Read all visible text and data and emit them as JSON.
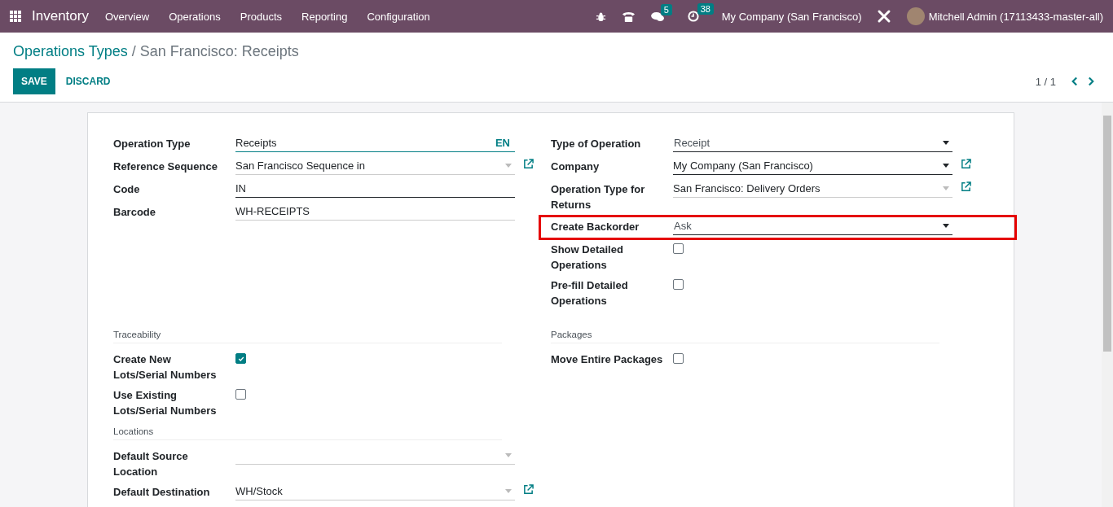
{
  "navbar": {
    "app_name": "Inventory",
    "menu": [
      "Overview",
      "Operations",
      "Products",
      "Reporting",
      "Configuration"
    ],
    "chat_badge": "5",
    "activity_badge": "38",
    "company": "My Company (San Francisco)",
    "user": "Mitchell Admin (17113433-master-all)"
  },
  "breadcrumb": {
    "parent": "Operations Types",
    "separator": "/",
    "current": "San Francisco: Receipts"
  },
  "buttons": {
    "save": "SAVE",
    "discard": "DISCARD"
  },
  "pager": "1 / 1",
  "left_fields": [
    {
      "kind": "translatable",
      "label": "Operation Type",
      "value": "Receipts",
      "lang": "EN",
      "required": false,
      "link": false
    },
    {
      "kind": "many2one",
      "label": "Reference Sequence",
      "value": "San Francisco Sequence in",
      "required": false,
      "link": true
    },
    {
      "kind": "text",
      "label": "Code",
      "value": "IN",
      "required": true,
      "link": false
    },
    {
      "kind": "text",
      "label": "Barcode",
      "value": "WH-RECEIPTS",
      "required": false,
      "link": false
    }
  ],
  "right_fields": [
    {
      "kind": "selection",
      "label": "Type of Operation",
      "value": "Receipt",
      "required": true,
      "link": false,
      "highlighted": false
    },
    {
      "kind": "many2one",
      "label": "Company",
      "value": "My Company (San Francisco)",
      "required": true,
      "link": true,
      "highlighted": false
    },
    {
      "kind": "many2one",
      "label": "Operation Type for Returns",
      "value": "San Francisco: Delivery Orders",
      "required": false,
      "link": true,
      "highlighted": false
    },
    {
      "kind": "selection",
      "label": "Create Backorder",
      "value": "Ask",
      "required": true,
      "link": false,
      "highlighted": true
    },
    {
      "kind": "checkbox",
      "label": "Show Detailed Operations",
      "checked": false,
      "highlighted": false
    },
    {
      "kind": "checkbox",
      "label": "Pre-fill Detailed Operations",
      "checked": false,
      "highlighted": false
    }
  ],
  "left_sections": [
    {
      "title": "Traceability",
      "fields": [
        {
          "kind": "checkbox",
          "label": "Create New Lots/Serial Numbers",
          "checked": true
        },
        {
          "kind": "checkbox",
          "label": "Use Existing Lots/Serial Numbers",
          "checked": false
        }
      ]
    },
    {
      "title": "Locations",
      "fields": [
        {
          "kind": "many2one",
          "label": "Default Source Location",
          "required": false,
          "link": false
        },
        {
          "kind": "many2one",
          "label": "Default Destination",
          "value": "WH/Stock",
          "required": false,
          "link": true
        }
      ]
    }
  ],
  "right_sections": [
    {
      "title": "Packages",
      "fields": [
        {
          "kind": "checkbox",
          "label": "Move Entire Packages",
          "checked": false
        }
      ]
    }
  ]
}
